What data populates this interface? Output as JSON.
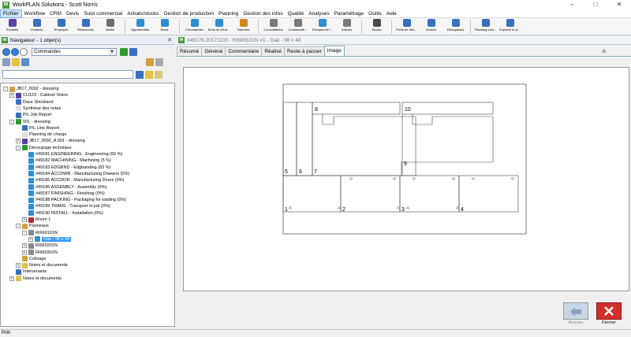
{
  "window": {
    "title": "WorkPLAN Solutions - Scott Norris",
    "app_icon": "W"
  },
  "menu": [
    "Fichier",
    "Workflow",
    "CRM",
    "Devis",
    "Suivi commercial",
    "Achats/stocks",
    "Gestion de production",
    "Planning",
    "Gestion des infos",
    "Qualité",
    "Analyses",
    "Paramétrage",
    "Outils",
    "Aide"
  ],
  "toolbar": [
    {
      "label": "Sociétés",
      "color": "#5a3fa8"
    },
    {
      "label": "Contacts",
      "color": "#3a6fc0"
    },
    {
      "label": "Employés",
      "color": "#3a6fc0"
    },
    {
      "label": "Ressources",
      "color": "#3a6fc0"
    },
    {
      "label": "Atelier",
      "color": "#6d6d6d"
    },
    {
      "label": "sep"
    },
    {
      "label": "Opportunités",
      "color": "#2b8fd1"
    },
    {
      "label": "Devis",
      "color": "#2b8fd1"
    },
    {
      "label": "sep"
    },
    {
      "label": "Commandes",
      "color": "#2b8fd1"
    },
    {
      "label": "Bons de livrai...",
      "color": "#2b8fd1"
    },
    {
      "label": "Factures",
      "color": "#d08a1a"
    },
    {
      "label": "sep"
    },
    {
      "label": "Consultations",
      "color": "#7a7a7a"
    },
    {
      "label": "Commande...",
      "color": "#7a7a7a"
    },
    {
      "label": "Réceptions f...",
      "color": "#2b8fd1"
    },
    {
      "label": "Articles",
      "color": "#7a7a7a"
    },
    {
      "label": "sep"
    },
    {
      "label": "Stocks",
      "color": "#4a4a4a"
    },
    {
      "label": "sep"
    },
    {
      "label": "Fiche de rem...",
      "color": "#3a6fc0"
    },
    {
      "label": "Actions",
      "color": "#3a6fc0"
    },
    {
      "label": "Dérogations",
      "color": "#3a6fc0"
    },
    {
      "label": "sep"
    },
    {
      "label": "Planning envi...",
      "color": "#3a6fc0"
    },
    {
      "label": "Exporter le pl...",
      "color": "#3a6fc0"
    }
  ],
  "navigator": {
    "title": "Navigateur - 1 objet(s)",
    "combo_value": "Commandes",
    "search_value": ""
  },
  "tree": [
    {
      "label": "JB17_0092 - dressing",
      "level": 0,
      "exp": "-",
      "icon": "#d0a040",
      "row": 0
    },
    {
      "label": "CU123 - Cabinet Vision",
      "level": 1,
      "exp": "+",
      "icon": "#5a3fa8",
      "row": 1
    },
    {
      "label": "Dave Strickland",
      "level": 1,
      "exp": "",
      "icon": "#3a6fc0",
      "row": 2
    },
    {
      "label": "Synthèse des notes",
      "level": 1,
      "exp": "",
      "icon": "#e0e0e0",
      "row": 3
    },
    {
      "label": "P/L Job Report",
      "level": 1,
      "exp": "",
      "icon": "#3a6fc0",
      "row": 4
    },
    {
      "label": "001 - dressing",
      "level": 1,
      "exp": "-",
      "icon": "#2f9a2f",
      "row": 5
    },
    {
      "label": "P/L Line Report",
      "level": 2,
      "exp": "",
      "icon": "#3a6fc0",
      "row": 6
    },
    {
      "label": "Planning de charge",
      "level": 2,
      "exp": "",
      "icon": "#e0e0e0",
      "row": 7
    },
    {
      "label": "JB17_0092_A 001 - dressing",
      "level": 2,
      "exp": "+",
      "icon": "#5a3fa8",
      "row": 8
    },
    {
      "label": "Découpage technique",
      "level": 2,
      "exp": "-",
      "icon": "#2f9a2f",
      "row": 9
    },
    {
      "label": "#49181 ENGINEERING - Engineering (60 %)",
      "level": 3,
      "exp": "",
      "icon": "#2b8fd1",
      "row": 10
    },
    {
      "label": "#49182 MACHINING - Machining (5 %)",
      "level": 3,
      "exp": "",
      "icon": "#2b8fd1",
      "row": 11
    },
    {
      "label": "#49183 EDGBND - Edgbanding (83 %)",
      "level": 3,
      "exp": "",
      "icon": "#2b8fd1",
      "row": 12
    },
    {
      "label": "#49184 ACCDWR - Manufacturing Drawers (0%)",
      "level": 3,
      "exp": "",
      "icon": "#2b8fd1",
      "row": 13
    },
    {
      "label": "#49185 ACCDOR - Manufacturing Doors (0%)",
      "level": 3,
      "exp": "",
      "icon": "#2b8fd1",
      "row": 14
    },
    {
      "label": "#49186 ASSEMBLY - Assembly (0%)",
      "level": 3,
      "exp": "",
      "icon": "#2b8fd1",
      "row": 15
    },
    {
      "label": "#49187 FINISHING - Finishing (0%)",
      "level": 3,
      "exp": "",
      "icon": "#2b8fd1",
      "row": 16
    },
    {
      "label": "#49188 PACKING - Packaging for loading (0%)",
      "level": 3,
      "exp": "",
      "icon": "#2b8fd1",
      "row": 17
    },
    {
      "label": "#49189 TRANS - Transport to job (0%)",
      "level": 3,
      "exp": "",
      "icon": "#2b8fd1",
      "row": 18
    },
    {
      "label": "#49190 INSTALL - Installation (0%)",
      "level": 3,
      "exp": "",
      "icon": "#2b8fd1",
      "row": 19
    },
    {
      "label": "Room 1",
      "level": 3,
      "exp": "+",
      "icon": "#b03030",
      "row": 20
    },
    {
      "label": "Panneaux",
      "level": 2,
      "exp": "-",
      "icon": "#d0a040",
      "row": 21
    },
    {
      "label": "RI660101N",
      "level": 3,
      "exp": "-",
      "icon": "#888888",
      "row": 22
    },
    {
      "label": "Oak - 96 x 48",
      "level": 4,
      "exp": "+",
      "icon": "#2b8fd1",
      "row": 23,
      "selected": true
    },
    {
      "label": "RI660201N",
      "level": 3,
      "exp": "+",
      "icon": "#888888",
      "row": 24
    },
    {
      "label": "RI660301N",
      "level": 3,
      "exp": "+",
      "icon": "#888888",
      "row": 25
    },
    {
      "label": "Colisage",
      "level": 2,
      "exp": "",
      "icon": "#d0a040",
      "row": 26
    },
    {
      "label": "Notes et documents",
      "level": 2,
      "exp": "+",
      "icon": "#e0c050",
      "row": 27
    },
    {
      "label": "Intervenants",
      "level": 1,
      "exp": "",
      "icon": "#3a6fc0",
      "row": 28
    },
    {
      "label": "Notes et documents",
      "level": 1,
      "exp": "+",
      "icon": "#e0c050",
      "row": 29
    }
  ],
  "document": {
    "title": "#49176 20171103 - RI660101N #1 - Oak - 96 x 48",
    "tabs": [
      "Résumé",
      "Général",
      "Commentaire",
      "Réalisé",
      "Reste à passer",
      "Image"
    ],
    "active_tab": "Image"
  },
  "parts": [
    "1",
    "2",
    "3",
    "4",
    "5",
    "6",
    "7",
    "8",
    "9",
    "10"
  ],
  "buttons": {
    "cancel_label": "Annuler",
    "close_label": "Fermer"
  },
  "status": "Prêt"
}
